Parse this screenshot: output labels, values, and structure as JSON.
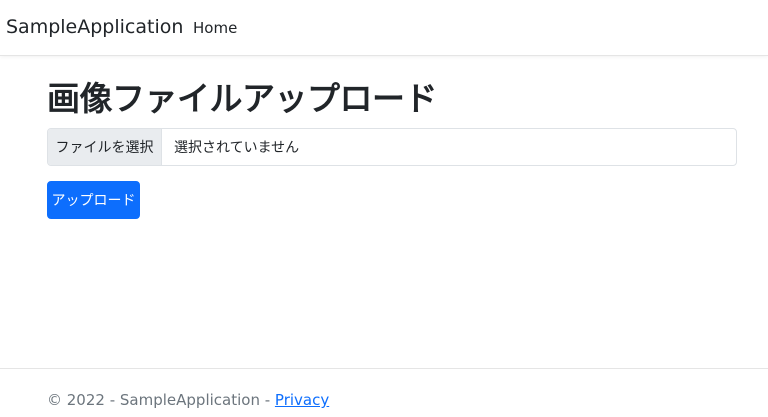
{
  "navbar": {
    "brand": "SampleApplication",
    "links": [
      {
        "label": "Home"
      }
    ]
  },
  "main": {
    "title": "画像ファイルアップロード",
    "file_input": {
      "button_label": "ファイルを選択",
      "status": "選択されていません"
    },
    "upload_button": "アップロード"
  },
  "footer": {
    "prefix": "© 2022 - SampleApplication - ",
    "privacy_link": "Privacy"
  },
  "colors": {
    "primary": "#0d6efd",
    "muted_text": "#6c757d"
  }
}
